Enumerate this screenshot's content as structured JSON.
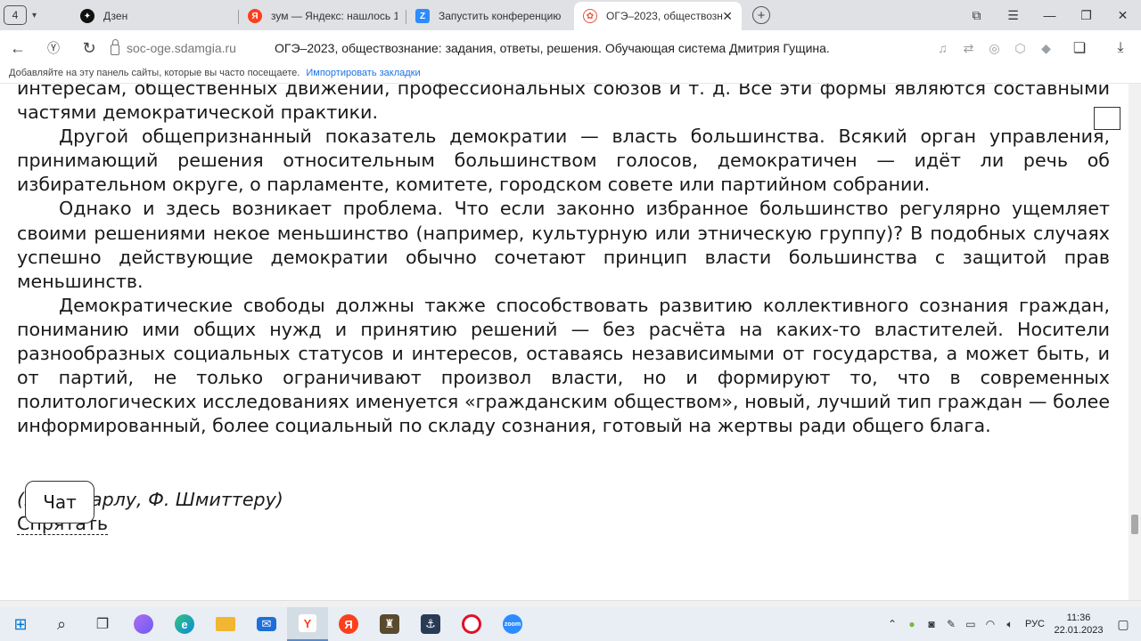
{
  "browser": {
    "tab_count": "4",
    "tabs": [
      {
        "title": "Дзен",
        "icon": "zen-icon",
        "color": "#111111",
        "glyph": "✦"
      },
      {
        "title": "зум — Яндекс: нашлось 1",
        "icon": "yandex-icon",
        "color": "#fc3f1d",
        "glyph": "Я"
      },
      {
        "title": "Запустить конференцию",
        "icon": "zoom-icon",
        "color": "#2d8cff",
        "glyph": "Z"
      },
      {
        "title": "ОГЭ–2023, обществозн",
        "icon": "sdamgia-icon",
        "color": "#e8533f",
        "glyph": "✿"
      }
    ],
    "address": {
      "domain": "soc-oge.sdamgia.ru",
      "page_title": "ОГЭ–2023, обществознание: задания, ответы, решения. Обучающая система Дмитрия Гущина."
    },
    "bookmarks_bar": {
      "prompt": "Добавляйте на эту панель сайты, которые вы часто посещаете.",
      "import_link": "Импортировать закладки"
    }
  },
  "article": {
    "paragraphs": [
      "интересам, общественных движений, профессиональных союзов и т. д. Все эти формы являются составными частями демократической практики.",
      "Другой общепризнанный показатель демократии — власть большинства. Всякий орган управления, принимающий решения относительным большинством голосов, демократичен — идёт ли речь об избирательном округе, о парламенте, комитете, городском совете или партийном собрании.",
      "Однако и здесь возникает проблема. Что если законно избранное большинство регулярно ущемляет своими решениями некое меньшинство (например, культурную или этническую группу)? В подобных случаях успешно действующие демократии обычно сочетают принцип власти большинства с защитой прав меньшинств.",
      "Демократические свободы должны также способствовать развитию коллективного сознания граждан, пониманию ими общих нужд и принятию решений — без расчёта на каких-то властителей. Носители разнообразных социальных статусов и интересов, оставаясь независимыми от государства, а может быть, и от партий, не только ограничивают произвол власти, но и формируют то, что в современных политологических исследованиях именуется «гражданским обществом», новый, лучший тип граждан — более информированный, более социальный по складу сознания, готовый на жертвы ради общего блага."
    ],
    "source": "(По Т. Карлу, Ф. Шмиттеру)",
    "hide_link": "Спрятать",
    "chat_button": "Чат"
  },
  "taskbar": {
    "apps": [
      {
        "name": "start-icon",
        "glyph": "⊞",
        "color": "#0078d4"
      },
      {
        "name": "search-icon",
        "glyph": "⌕",
        "color": "#333333"
      },
      {
        "name": "task-view-icon",
        "glyph": "❐",
        "color": "#333333"
      },
      {
        "name": "alice-icon",
        "glyph": "●",
        "color": "#8a5cf6"
      },
      {
        "name": "edge-icon",
        "glyph": "e",
        "color": "#0c8ad8"
      },
      {
        "name": "explorer-icon",
        "glyph": "▬",
        "color": "#f2b632"
      },
      {
        "name": "mail-icon",
        "glyph": "✉",
        "color": "#1e6fd9"
      },
      {
        "name": "yandex-browser-icon",
        "glyph": "Y",
        "color": "#fc3f1d"
      },
      {
        "name": "yandex-icon",
        "glyph": "Я",
        "color": "#fc3f1d"
      },
      {
        "name": "world-of-tanks-icon",
        "glyph": "♜",
        "color": "#5a4a2e"
      },
      {
        "name": "world-of-warships-icon",
        "glyph": "⚓",
        "color": "#2a3b55"
      },
      {
        "name": "opera-icon",
        "glyph": "O",
        "color": "#e0102a"
      },
      {
        "name": "zoom-taskbar-icon",
        "glyph": "Z",
        "color": "#2d8cff"
      }
    ],
    "language": "РУС",
    "time": "11:36",
    "date": "22.01.2023"
  }
}
